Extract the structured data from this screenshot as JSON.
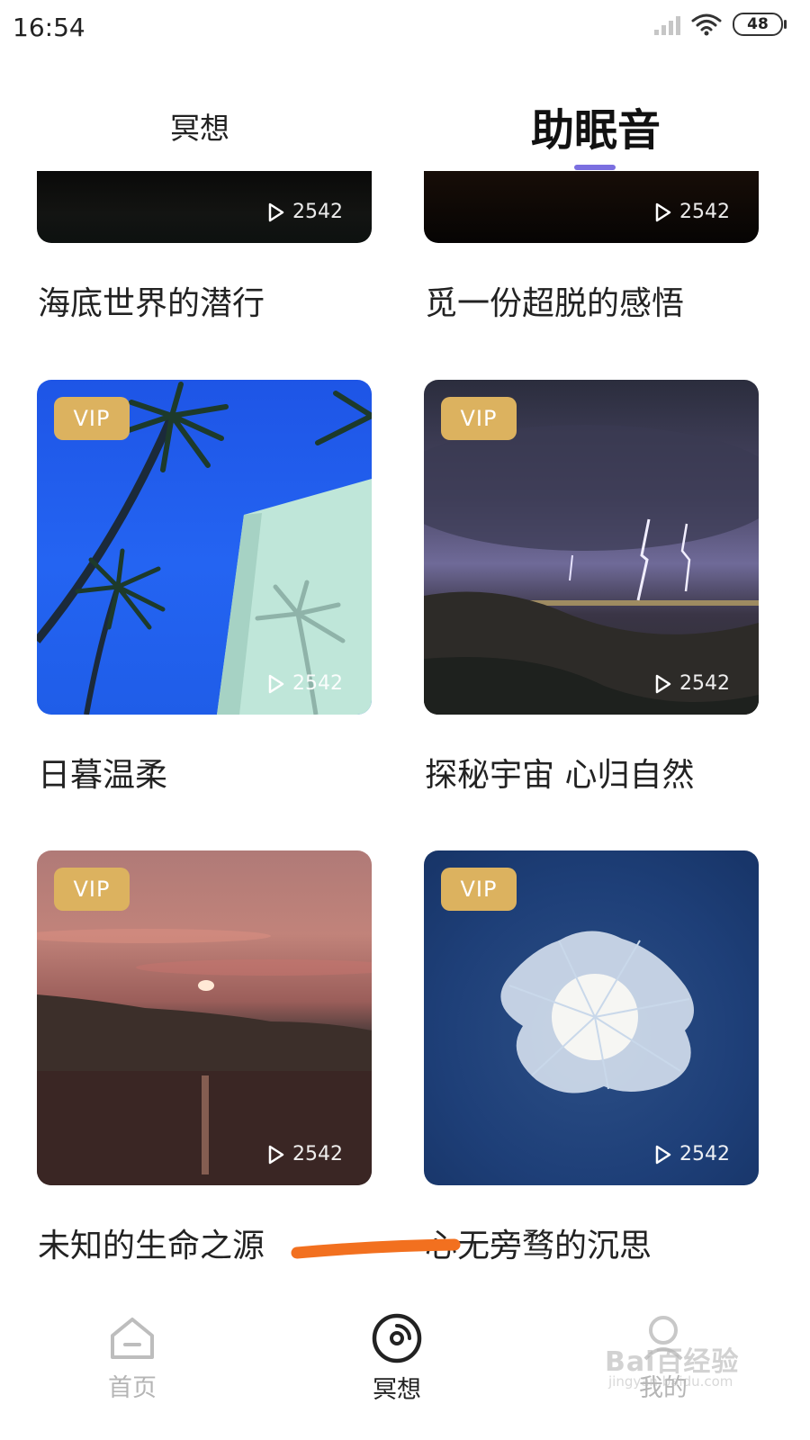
{
  "status_bar": {
    "time": "16:54",
    "battery": "48"
  },
  "tabs": [
    {
      "label": "冥想",
      "active": false
    },
    {
      "label": "助眠音",
      "active": true
    }
  ],
  "accent_color": "#7b6fe0",
  "vip_color": "#dcb25f",
  "cards": [
    {
      "title": "海底世界的潜行",
      "plays": "2542",
      "vip": false,
      "scene": "dark underwater"
    },
    {
      "title": "觅一份超脱的感悟",
      "plays": "2542",
      "vip": false,
      "scene": "dark gradient"
    },
    {
      "title": "日暮温柔",
      "plays": "2542",
      "vip": true,
      "vip_label": "VIP",
      "scene": "palm trees blue sky"
    },
    {
      "title": "探秘宇宙 心归自然",
      "plays": "2542",
      "vip": true,
      "vip_label": "VIP",
      "scene": "lightning storm over city"
    },
    {
      "title": "未知的生命之源",
      "plays": "2542",
      "vip": true,
      "vip_label": "VIP",
      "scene": "pink dusk over lake"
    },
    {
      "title": "心无旁骛的沉思",
      "plays": "2542",
      "vip": true,
      "vip_label": "VIP",
      "scene": "white flower on blue"
    }
  ],
  "bottom_nav": [
    {
      "label": "首页",
      "icon": "home-icon",
      "active": false
    },
    {
      "label": "冥想",
      "icon": "disc-icon",
      "active": true
    },
    {
      "label": "我的",
      "icon": "profile-icon",
      "active": false
    }
  ],
  "watermark": {
    "brand": "Bai百经验",
    "url": "jingyan.baidu.com"
  }
}
